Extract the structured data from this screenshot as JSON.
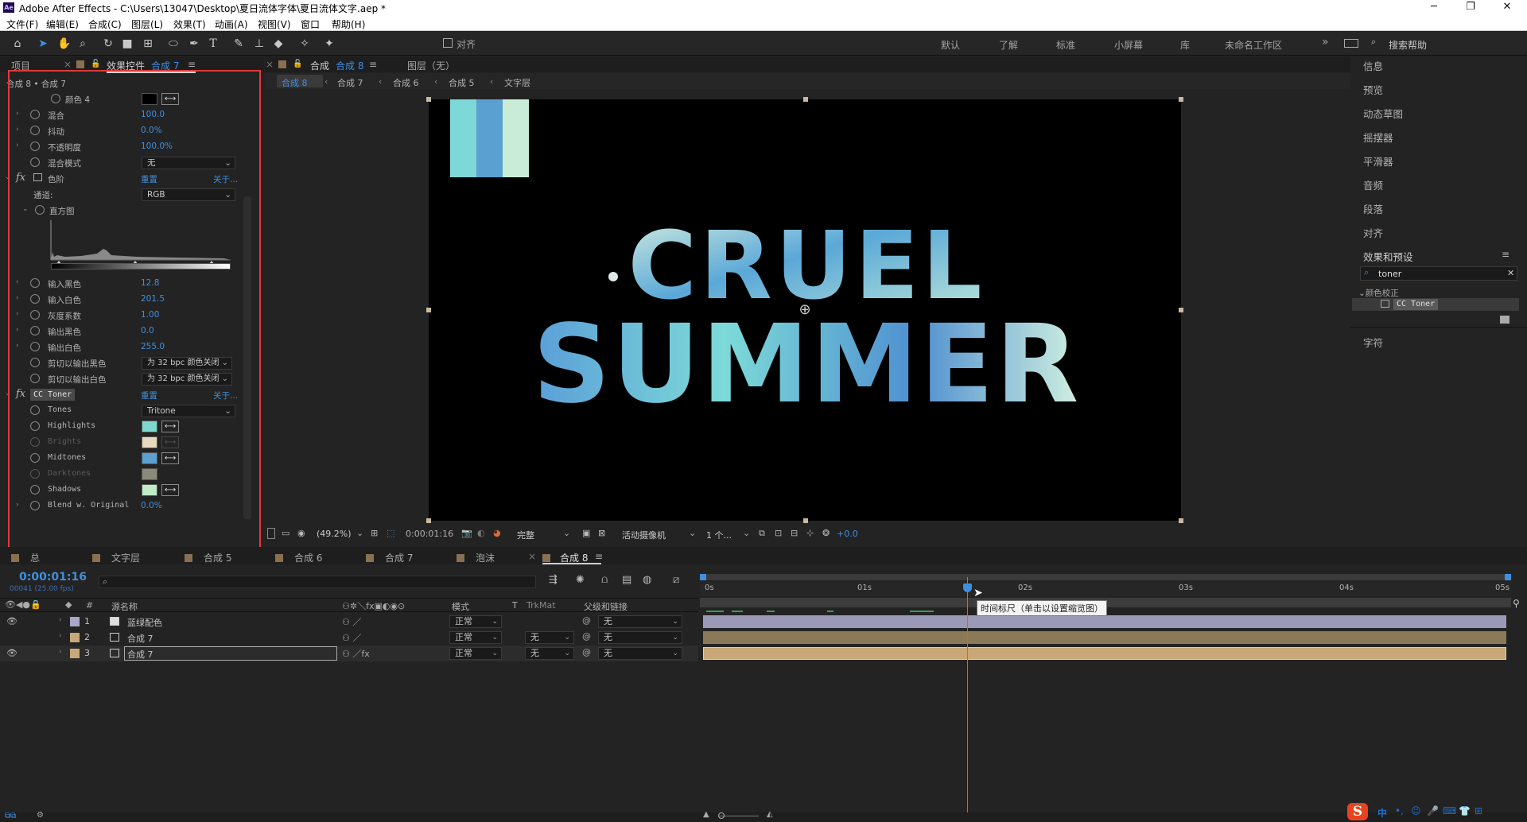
{
  "window": {
    "title": "Adobe After Effects - C:\\Users\\13047\\Desktop\\夏日流体字体\\夏日流体文字.aep *",
    "app_logo": "Ae",
    "minimize": "─",
    "restore": "❐",
    "close": "✕"
  },
  "menu": [
    "文件(F)",
    "编辑(E)",
    "合成(C)",
    "图层(L)",
    "效果(T)",
    "动画(A)",
    "视图(V)",
    "窗口",
    "帮助(H)"
  ],
  "toolbar": {
    "align_label": "对齐",
    "workspaces": [
      "默认",
      "了解",
      "标准",
      "小屏幕",
      "库",
      "未命名工作区"
    ],
    "more": "»",
    "search_placeholder": "搜索帮助",
    "tools": [
      "home-icon",
      "selection-arrow-icon",
      "hand-icon",
      "zoom-icon",
      "rotate-icon",
      "camera-icon",
      "pan-behind-icon",
      "ellipse-icon",
      "pen-icon",
      "type-icon",
      "brush-icon",
      "clone-stamp-icon",
      "eraser-icon",
      "roto-brush-icon",
      "puppet-pin-icon"
    ]
  },
  "project_tab": "项目",
  "effects_tab": {
    "label": "效果控件",
    "comp": "合成 7",
    "menu": "≡"
  },
  "ec_breadcrumb": "合成 8 • 合成 7",
  "ec": {
    "rows": [
      {
        "label": "颜色 4",
        "value": "",
        "swatch": "#000000"
      },
      {
        "label": "混合",
        "value": "100.0"
      },
      {
        "label": "抖动",
        "value": "0.0%"
      },
      {
        "label": "不透明度",
        "value": "100.0%"
      },
      {
        "label": "混合模式",
        "dropdown": "无"
      }
    ],
    "levels": {
      "name": "色阶",
      "reset": "重置",
      "about": "关于...",
      "channel_label": "通道:",
      "channel": "RGB",
      "histogram_label": "直方图",
      "params": [
        {
          "label": "输入黑色",
          "value": "12.8"
        },
        {
          "label": "输入白色",
          "value": "201.5"
        },
        {
          "label": "灰度系数",
          "value": "1.00"
        },
        {
          "label": "输出黑色",
          "value": "0.0"
        },
        {
          "label": "输出白色",
          "value": "255.0"
        }
      ],
      "clip_black_label": "剪切以输出黑色",
      "clip_black": "为 32 bpc 颜色关闭",
      "clip_white_label": "剪切以输出白色",
      "clip_white": "为 32 bpc 颜色关闭"
    },
    "toner": {
      "name": "CC Toner",
      "reset": "重置",
      "about": "关于...",
      "tones_label": "Tones",
      "tones": "Tritone",
      "colors": [
        {
          "label": "Highlights",
          "color": "#7dd8d0",
          "enabled": true
        },
        {
          "label": "Brights",
          "color": "#e8d8c0",
          "enabled": false
        },
        {
          "label": "Midtones",
          "color": "#5aa0d0",
          "enabled": true
        },
        {
          "label": "Darktones",
          "color": "#8a8a7a",
          "enabled": false
        },
        {
          "label": "Shadows",
          "color": "#c0ecc8",
          "enabled": true
        }
      ],
      "blend_label": "Blend w. Original",
      "blend": "0.0%"
    }
  },
  "comp_panel": {
    "tab": "合成",
    "comp": "合成 8",
    "menu": "≡",
    "layer_tab": "图层（无）",
    "breadcrumbs": [
      "合成 8",
      "合成 7",
      "合成 6",
      "合成 5",
      "文字层"
    ],
    "canvas_text_line1": "CRUEL",
    "canvas_text_line2": "SUMMER",
    "footer": {
      "zoom": "(49.2%)",
      "timecode": "0:00:01:16",
      "quality": "完整",
      "camera": "活动摄像机",
      "views": "1 个...",
      "exposure": "+0.0"
    }
  },
  "right_panels": [
    "信息",
    "预览",
    "动态草图",
    "摇摆器",
    "平滑器",
    "音频",
    "段落",
    "对齐"
  ],
  "effects_presets": {
    "title": "效果和预设",
    "search": "toner",
    "category": "颜色校正",
    "item": "CC Toner",
    "menu": "≡"
  },
  "char_panel": "字符",
  "timeline": {
    "tabs": [
      "总",
      "文字层",
      "合成 5",
      "合成 6",
      "合成 7",
      "泡沫",
      "合成 8"
    ],
    "active_tab": "合成 8",
    "timecode": "0:00:01:16",
    "fps": "00041 (25.00 fps)",
    "col_headers": {
      "source": "源名称",
      "mode": "模式",
      "t": "T",
      "trkmat": "TrkMat",
      "parent": "父级和链接",
      "hash": "#"
    },
    "ruler": [
      "0s",
      "01s",
      "02s",
      "03s",
      "04s",
      "05s"
    ],
    "tooltip": "时间标尺（单击以设置缩览图）",
    "layers": [
      {
        "num": "1",
        "name": "蓝绿配色",
        "color": "#a8a8c8",
        "mode": "正常",
        "trkmat": "",
        "parent": "无",
        "visible": true
      },
      {
        "num": "2",
        "name": "合成 7",
        "color": "#c8a878",
        "mode": "正常",
        "trkmat": "无",
        "parent": "无",
        "visible": false
      },
      {
        "num": "3",
        "name": "合成 7",
        "color": "#c8a878",
        "mode": "正常",
        "trkmat": "无",
        "parent": "无",
        "visible": true
      }
    ]
  },
  "ime": {
    "s": "S",
    "items": [
      "中",
      "•,",
      "☺",
      "🎤",
      "⌨",
      "👕",
      "⊞"
    ]
  }
}
